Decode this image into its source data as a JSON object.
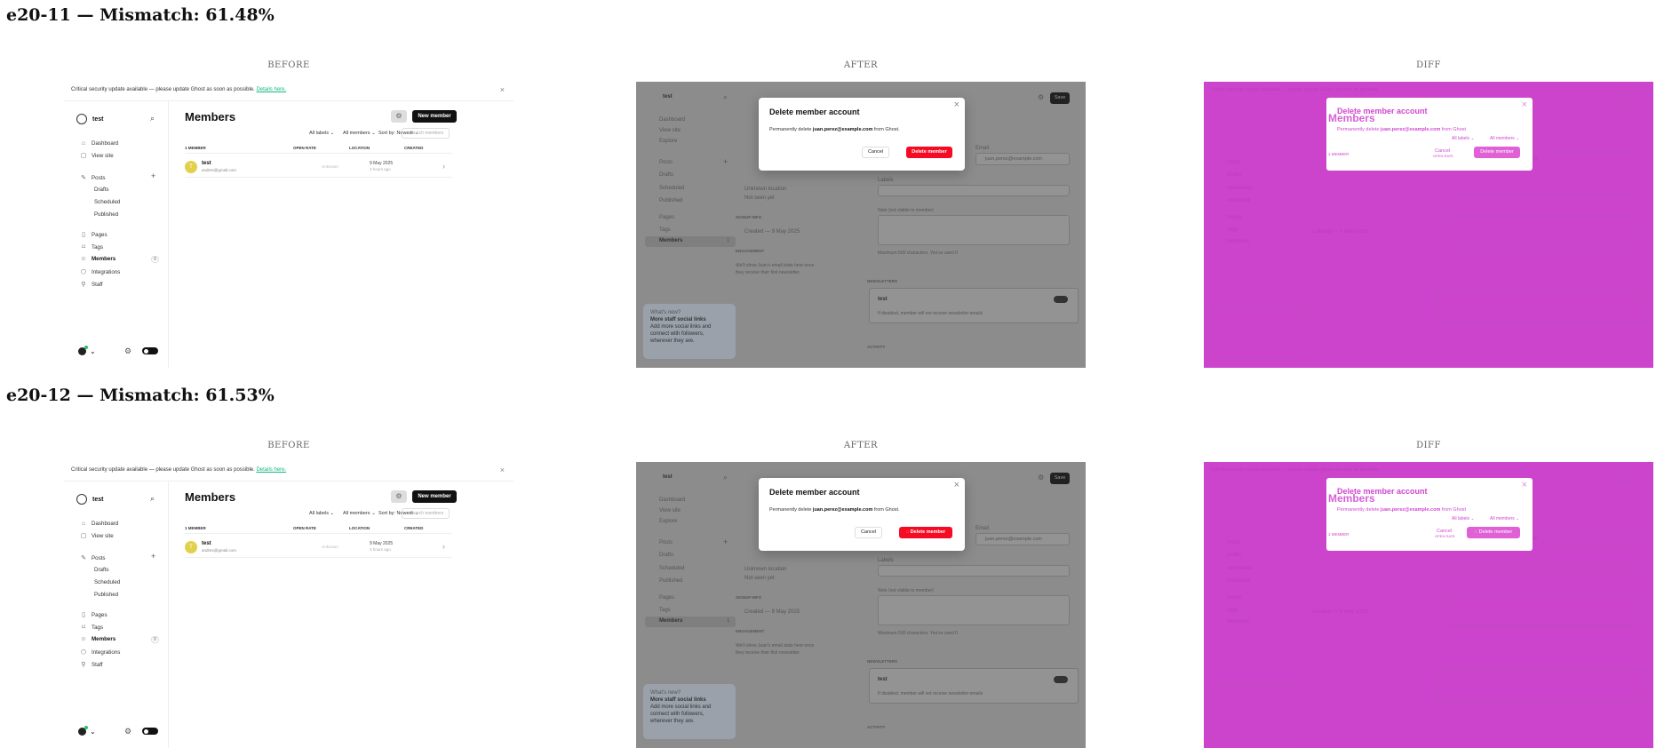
{
  "sections": [
    {
      "heading": "e20-11 — Mismatch: 61.48%",
      "col_labels": [
        "BEFORE",
        "AFTER",
        "DIFF"
      ],
      "after": {
        "cancel_label": "Cancel",
        "delete_label": "Delete member",
        "delete_has_spinner": false
      }
    },
    {
      "heading": "e20-12 — Mismatch: 61.53%",
      "col_labels": [
        "BEFORE",
        "AFTER",
        "DIFF"
      ],
      "after": {
        "cancel_label": "Cancel",
        "delete_label": "Delete member",
        "delete_has_spinner": true
      }
    }
  ],
  "before": {
    "banner_text": "Critical security update available — please update Ghost as soon as possible.",
    "banner_link": "Details here.",
    "site_name": "test",
    "nav": [
      "Dashboard",
      "View site"
    ],
    "posts": "Posts",
    "posts_sub": [
      "Drafts",
      "Scheduled",
      "Published"
    ],
    "nav2": [
      "Pages",
      "Tags",
      "Members",
      "Integrations",
      "Staff"
    ],
    "members_count": "0",
    "page_title": "Members",
    "new_member": "New member",
    "filters": [
      "All labels ⌄",
      "All members ⌄",
      "Sort by: Newest ⌄"
    ],
    "search_placeholder": "Search members",
    "columns": [
      "1 MEMBER",
      "OPEN RATE",
      "LOCATION",
      "CREATED"
    ],
    "row": {
      "initial": "T",
      "name": "test",
      "email": "andres@gmail.com",
      "location": "Unknown",
      "date": "9 May 2025",
      "ago": "3 hours ago"
    }
  },
  "after_common": {
    "site_name": "test",
    "nav": [
      "Dashboard",
      "View site",
      "Explore"
    ],
    "posts": "Posts",
    "posts_sub": [
      "Drafts",
      "Scheduled",
      "Published"
    ],
    "nav2": [
      "Pages",
      "Tags",
      "Members"
    ],
    "members_count": "1",
    "save": "Save",
    "modal_title": "Delete member account",
    "modal_text_pre": "Permanently delete ",
    "modal_email": "juan.perez@example.com",
    "modal_text_post": " from Ghost.",
    "email_label": "Email",
    "email_value": "juan.perez@example.com",
    "labels_label": "Labels",
    "note_label": "Note (not visible to member)",
    "note_hint": "Maximum 500 characters. You've used 0",
    "newsletters": "NEWSLETTERS",
    "newsletter_name": "test",
    "newsletter_hint": "If disabled, member will not receive newsletter emails",
    "activity": "ACTIVITY",
    "unknown_location": "Unknown location",
    "not_seen": "Not seen yet",
    "signup_info": "SIGNUP INFO",
    "created": "Created — 9 May 2025",
    "engagement": "ENGAGEMENT",
    "engagement_text_1": "We'll show Juan's email stats here once",
    "engagement_text_2": "they receive their first newsletter.",
    "whats_new": "What's new?",
    "promo_title": "More staff social links",
    "promo_text_1": "Add more social links and",
    "promo_text_2": "connect with followers,",
    "promo_text_3": "wherever they are."
  },
  "diff_common": {
    "title": "Delete member account",
    "underlay_title": "Members",
    "text_pre": "Permanently delete ",
    "email": "juan.perez@example.com",
    "text_post": " from Ghost",
    "cancel": "Cancel",
    "cancel_under": "OPEN RATE",
    "delete": "Delete member",
    "filter1": "All labels ⌄",
    "filter2": "All members ⌄",
    "member_col": "1 MEMBER"
  },
  "colors": {
    "danger": "#f50b23",
    "diff": "#cc44cc",
    "accent_green": "#14b886"
  }
}
